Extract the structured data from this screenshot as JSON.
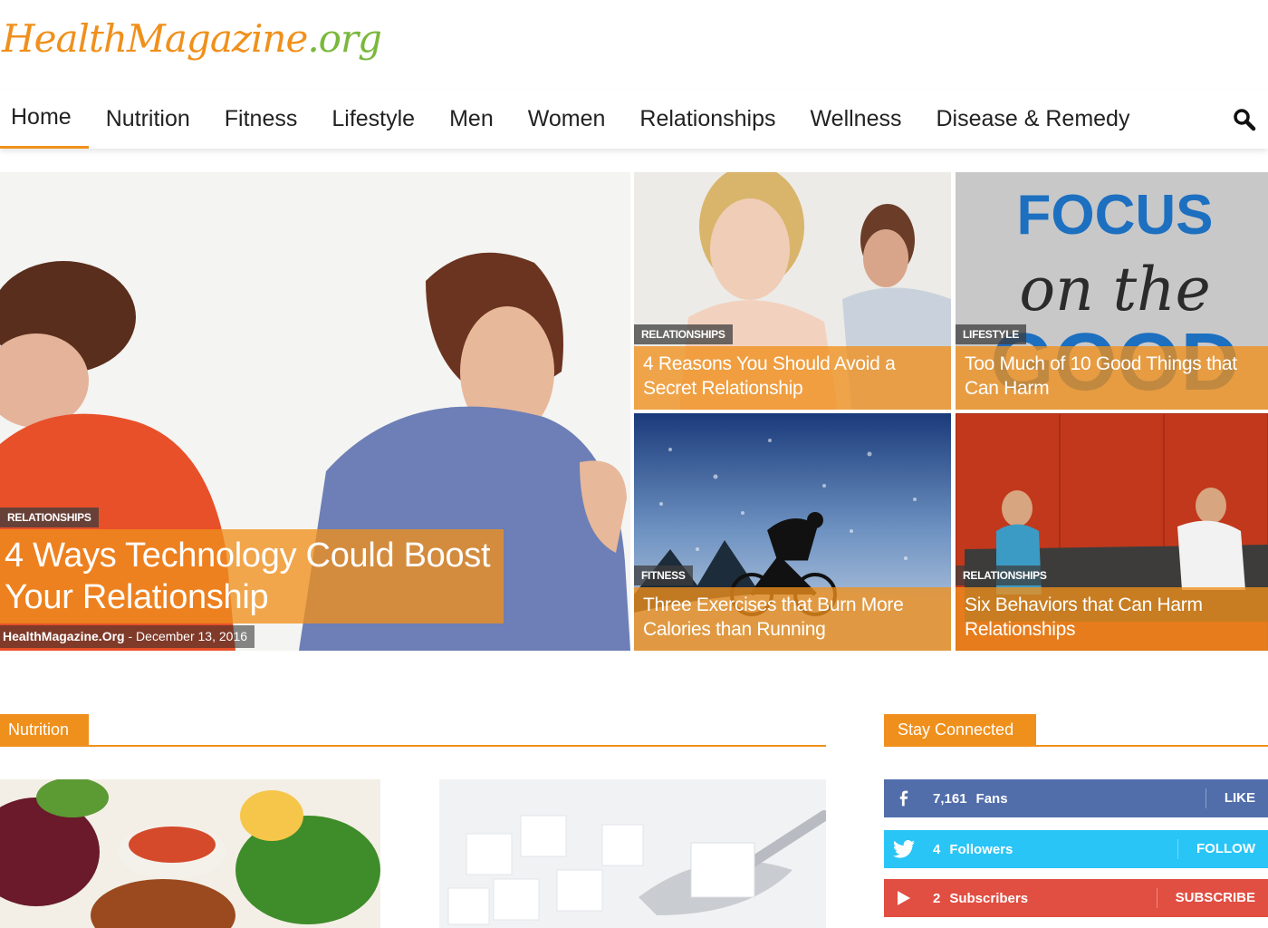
{
  "site": {
    "logo_main": "HealthMagazine",
    "logo_tld": ".org"
  },
  "nav": {
    "items": [
      "Home",
      "Nutrition",
      "Fitness",
      "Lifestyle",
      "Men",
      "Women",
      "Relationships",
      "Wellness",
      "Disease & Remedy"
    ],
    "active": "Home",
    "search_icon": "search-icon"
  },
  "hero": {
    "category": "RELATIONSHIPS",
    "title": "4 Ways Technology Could Boost Your Relationship",
    "author": "HealthMagazine.Org",
    "separator": "-",
    "date": "December 13, 2016"
  },
  "tiles": [
    {
      "category": "RELATIONSHIPS",
      "title": "4 Reasons You Should Avoid a Secret Relationship"
    },
    {
      "category": "LIFESTYLE",
      "title": "Too Much of 10 Good Things that Can Harm",
      "image_text_1": "FOCUS",
      "image_text_2": "on the",
      "image_text_3": "GOOD"
    },
    {
      "category": "FITNESS",
      "title": "Three Exercises that Burn More Calories than Running"
    },
    {
      "category": "RELATIONSHIPS",
      "title": "Six Behaviors that Can Harm Relationships"
    }
  ],
  "sections": {
    "nutrition": "Nutrition",
    "stay_connected": "Stay Connected"
  },
  "social": {
    "facebook": {
      "icon": "facebook-icon",
      "count": "7,161",
      "label": "Fans",
      "action": "LIKE",
      "color": "#516eab"
    },
    "twitter": {
      "icon": "twitter-icon",
      "count": "4",
      "label": "Followers",
      "action": "FOLLOW",
      "color": "#29c5f6"
    },
    "youtube": {
      "icon": "youtube-icon",
      "count": "2",
      "label": "Subscribers",
      "action": "SUBSCRIBE",
      "color": "#e14e42"
    }
  },
  "colors": {
    "accent": "#f0901c",
    "logo_green": "#7ab83c"
  }
}
